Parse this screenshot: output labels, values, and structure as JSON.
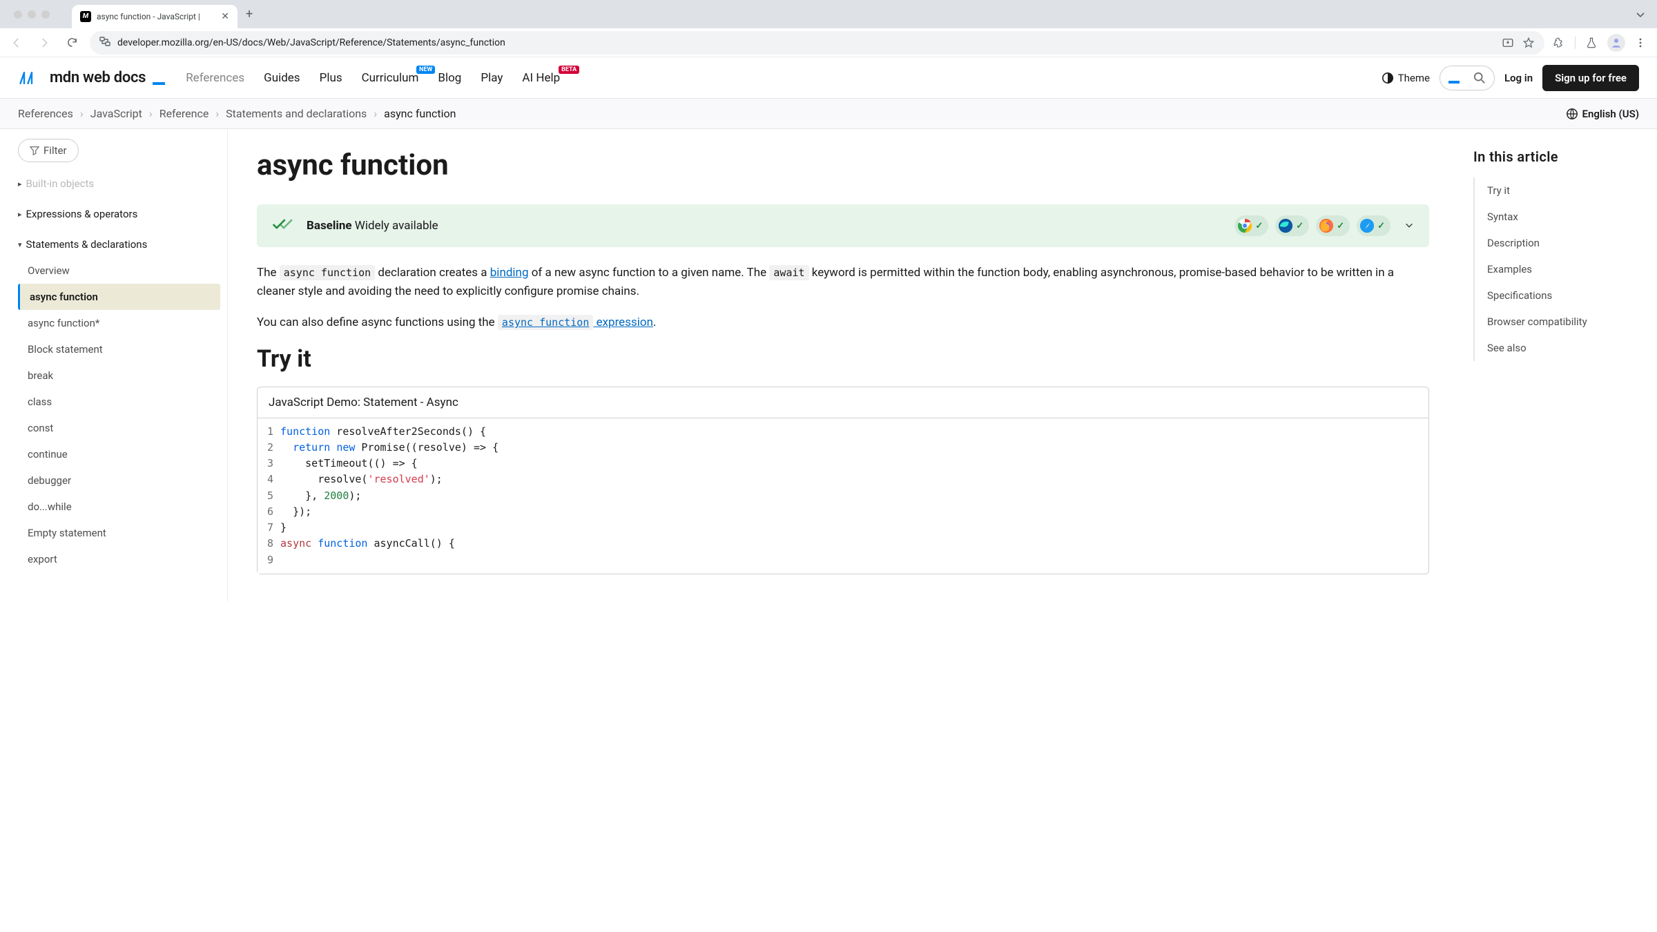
{
  "browser": {
    "tab_title": "async function - JavaScript |",
    "url": "developer.mozilla.org/en-US/docs/Web/JavaScript/Reference/Statements/async_function"
  },
  "header": {
    "logo_text": "mdn web docs",
    "nav": {
      "references": "References",
      "guides": "Guides",
      "plus": "Plus",
      "curriculum": "Curriculum",
      "curriculum_badge": "NEW",
      "blog": "Blog",
      "play": "Play",
      "ai_help": "AI Help",
      "ai_help_badge": "BETA"
    },
    "theme": "Theme",
    "login": "Log in",
    "signup": "Sign up for free"
  },
  "breadcrumbs": {
    "items": [
      "References",
      "JavaScript",
      "Reference",
      "Statements and declarations",
      "async function"
    ],
    "language": "English (US)"
  },
  "sidebar": {
    "filter": "Filter",
    "group_builtin": "Built-in objects",
    "group_expr": "Expressions & operators",
    "group_stmt": "Statements & declarations",
    "items": [
      "Overview",
      "async function",
      "async function*",
      "Block statement",
      "break",
      "class",
      "const",
      "continue",
      "debugger",
      "do...while",
      "Empty statement",
      "export"
    ]
  },
  "main": {
    "title": "async function",
    "baseline_strong": "Baseline",
    "baseline_rest": " Widely available",
    "para1_a": "The ",
    "code_async_function": "async function",
    "para1_b": " declaration creates a ",
    "link_binding": "binding",
    "para1_c": " of a new async function to a given name. The ",
    "code_await": "await",
    "para1_d": " keyword is permitted within the function body, enabling asynchronous, promise-based behavior to be written in a cleaner style and avoiding the need to explicitly configure promise chains.",
    "para2_a": "You can also define async functions using the ",
    "link_expression_code": "async function",
    "link_expression_text": " expression",
    "para2_b": ".",
    "try_it": "Try it",
    "demo_title": "JavaScript Demo: Statement - Async",
    "line_numbers": [
      "1",
      "2",
      "3",
      "4",
      "5",
      "6",
      "7",
      "8",
      "9"
    ],
    "code": {
      "l1_kw": "function",
      "l1_rest": " resolveAfter2Seconds() {",
      "l2_pad": "  ",
      "l2_kw1": "return",
      "l2_sp": " ",
      "l2_kw2": "new",
      "l2_rest": " Promise((resolve) => {",
      "l3": "    setTimeout(() => {",
      "l4_a": "      resolve(",
      "l4_str": "'resolved'",
      "l4_b": ");",
      "l5_a": "    }, ",
      "l5_num": "2000",
      "l5_b": ");",
      "l6": "  });",
      "l7": "}",
      "l8": "",
      "l9_async": "async",
      "l9_sp": " ",
      "l9_kw": "function",
      "l9_rest": " asyncCall() {"
    }
  },
  "toc": {
    "title": "In this article",
    "items": [
      "Try it",
      "Syntax",
      "Description",
      "Examples",
      "Specifications",
      "Browser compatibility",
      "See also"
    ]
  }
}
